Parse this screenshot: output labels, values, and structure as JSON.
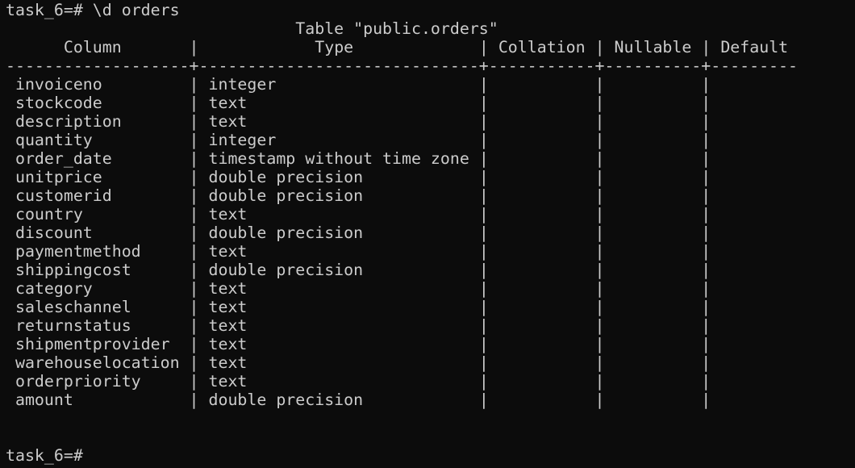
{
  "terminal": {
    "prompt": "task_6=#",
    "command": "\\d orders",
    "final_prompt": "task_6=#"
  },
  "table": {
    "title": "Table \"public.orders\"",
    "headers": [
      "Column",
      "Type",
      "Collation",
      "Nullable",
      "Default"
    ],
    "rows": [
      {
        "column": "invoiceno",
        "type": "integer",
        "collation": "",
        "nullable": "",
        "default": ""
      },
      {
        "column": "stockcode",
        "type": "text",
        "collation": "",
        "nullable": "",
        "default": ""
      },
      {
        "column": "description",
        "type": "text",
        "collation": "",
        "nullable": "",
        "default": ""
      },
      {
        "column": "quantity",
        "type": "integer",
        "collation": "",
        "nullable": "",
        "default": ""
      },
      {
        "column": "order_date",
        "type": "timestamp without time zone",
        "collation": "",
        "nullable": "",
        "default": ""
      },
      {
        "column": "unitprice",
        "type": "double precision",
        "collation": "",
        "nullable": "",
        "default": ""
      },
      {
        "column": "customerid",
        "type": "double precision",
        "collation": "",
        "nullable": "",
        "default": ""
      },
      {
        "column": "country",
        "type": "text",
        "collation": "",
        "nullable": "",
        "default": ""
      },
      {
        "column": "discount",
        "type": "double precision",
        "collation": "",
        "nullable": "",
        "default": ""
      },
      {
        "column": "paymentmethod",
        "type": "text",
        "collation": "",
        "nullable": "",
        "default": ""
      },
      {
        "column": "shippingcost",
        "type": "double precision",
        "collation": "",
        "nullable": "",
        "default": ""
      },
      {
        "column": "category",
        "type": "text",
        "collation": "",
        "nullable": "",
        "default": ""
      },
      {
        "column": "saleschannel",
        "type": "text",
        "collation": "",
        "nullable": "",
        "default": ""
      },
      {
        "column": "returnstatus",
        "type": "text",
        "collation": "",
        "nullable": "",
        "default": ""
      },
      {
        "column": "shipmentprovider",
        "type": "text",
        "collation": "",
        "nullable": "",
        "default": ""
      },
      {
        "column": "warehouselocation",
        "type": "text",
        "collation": "",
        "nullable": "",
        "default": ""
      },
      {
        "column": "orderpriority",
        "type": "text",
        "collation": "",
        "nullable": "",
        "default": ""
      },
      {
        "column": "amount",
        "type": "double precision",
        "collation": "",
        "nullable": "",
        "default": ""
      }
    ]
  },
  "colors": {
    "background": "#0c0c0c",
    "foreground": "#cccccc"
  }
}
